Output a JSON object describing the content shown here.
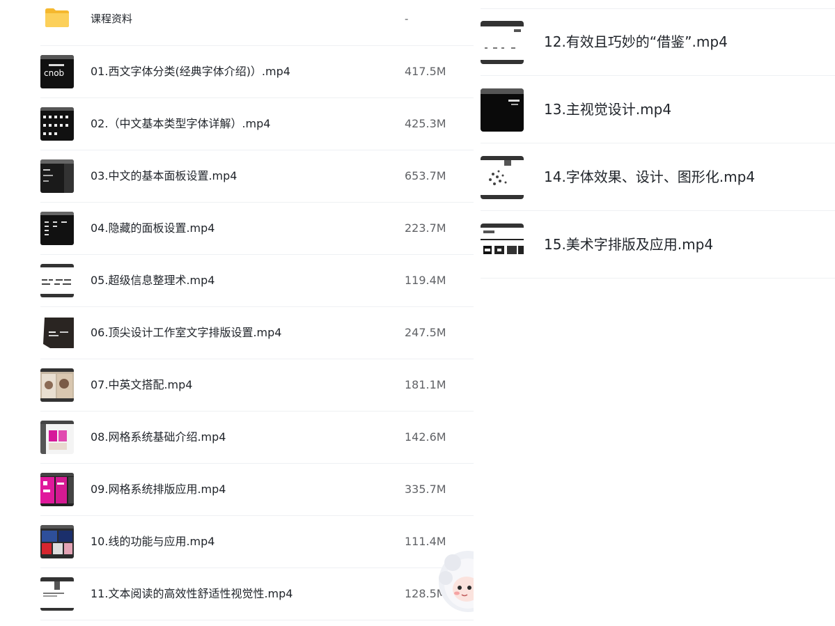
{
  "folder": {
    "name": "课程资料",
    "size": "-"
  },
  "files_left": [
    {
      "name": "01.西文字体分类(经典字体介绍)）.mp4",
      "size": "417.5M",
      "thumb_text": "cnob",
      "icon": "video-thumbnail"
    },
    {
      "name": "02.（中文基本类型字体详解）.mp4",
      "size": "425.3M",
      "icon": "video-thumbnail"
    },
    {
      "name": "03.中文的基本面板设置.mp4",
      "size": "653.7M",
      "icon": "video-thumbnail"
    },
    {
      "name": "04.隐藏的面板设置.mp4",
      "size": "223.7M",
      "icon": "video-thumbnail"
    },
    {
      "name": "05.超级信息整理术.mp4",
      "size": "119.4M",
      "icon": "video-thumbnail"
    },
    {
      "name": "06.顶尖设计工作室文字排版设置.mp4",
      "size": "247.5M",
      "icon": "video-thumbnail"
    },
    {
      "name": "07.中英文搭配.mp4",
      "size": "181.1M",
      "icon": "video-thumbnail"
    },
    {
      "name": "08.网格系统基础介绍.mp4",
      "size": "142.6M",
      "icon": "video-thumbnail"
    },
    {
      "name": "09.网格系统排版应用.mp4",
      "size": "335.7M",
      "icon": "video-thumbnail"
    },
    {
      "name": "10.线的功能与应用.mp4",
      "size": "111.4M",
      "icon": "video-thumbnail"
    },
    {
      "name": "11.文本阅读的高效性舒适性视觉性.mp4",
      "size": "128.5M",
      "icon": "video-thumbnail"
    }
  ],
  "files_right": [
    {
      "name": "12.有效且巧妙的“借鉴”.mp4",
      "icon": "video-thumbnail"
    },
    {
      "name": "13.主视觉设计.mp4",
      "icon": "video-thumbnail"
    },
    {
      "name": "14.字体效果、设计、图形化.mp4",
      "icon": "video-thumbnail"
    },
    {
      "name": "15.美术字排版及应用.mp4",
      "icon": "video-thumbnail"
    }
  ],
  "colors": {
    "folder": "#f7c744",
    "divider": "#eef0f3",
    "text": "#1f2329",
    "size_text": "#606266"
  }
}
